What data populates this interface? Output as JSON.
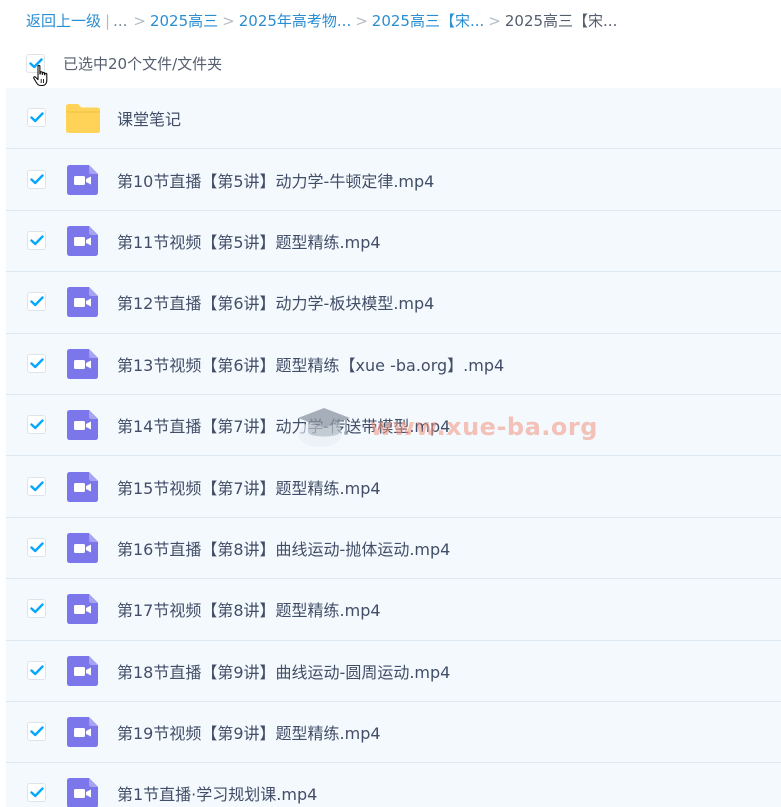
{
  "breadcrumb": {
    "back_label": "返回上一级",
    "pipe": "|",
    "ellipsis": "...",
    "separator": ">",
    "items": [
      "2025高三",
      "2025年高考物...",
      "2025高三【宋..."
    ],
    "current": "2025高三【宋..."
  },
  "selection": {
    "checked": true,
    "label": "已选中20个文件/文件夹"
  },
  "colors": {
    "link": "#2a8ed3",
    "checkmark": "#06a7ff",
    "folder": "#ffd258",
    "video_icon": "#7b76ea",
    "list_bg": "#f3f9fd"
  },
  "files": [
    {
      "name": "课堂笔记",
      "type": "folder",
      "checked": true
    },
    {
      "name": "第10节直播【第5讲】动力学-牛顿定律.mp4",
      "type": "video",
      "checked": true
    },
    {
      "name": "第11节视频【第5讲】题型精练.mp4",
      "type": "video",
      "checked": true
    },
    {
      "name": "第12节直播【第6讲】动力学-板块模型.mp4",
      "type": "video",
      "checked": true
    },
    {
      "name": "第13节视频【第6讲】题型精练【xue -ba.org】.mp4",
      "type": "video",
      "checked": true
    },
    {
      "name": "第14节直播【第7讲】动力学-传送带模型.mp4",
      "type": "video",
      "checked": true
    },
    {
      "name": "第15节视频【第7讲】题型精练.mp4",
      "type": "video",
      "checked": true
    },
    {
      "name": "第16节直播【第8讲】曲线运动-抛体运动.mp4",
      "type": "video",
      "checked": true
    },
    {
      "name": "第17节视频【第8讲】题型精练.mp4",
      "type": "video",
      "checked": true
    },
    {
      "name": "第18节直播【第9讲】曲线运动-圆周运动.mp4",
      "type": "video",
      "checked": true
    },
    {
      "name": "第19节视频【第9讲】题型精练.mp4",
      "type": "video",
      "checked": true
    },
    {
      "name": "第1节直播·学习规划课.mp4",
      "type": "video",
      "checked": true
    }
  ],
  "watermark": {
    "text": "www.xue-ba.org",
    "icon": "graduation-cap-icon"
  }
}
